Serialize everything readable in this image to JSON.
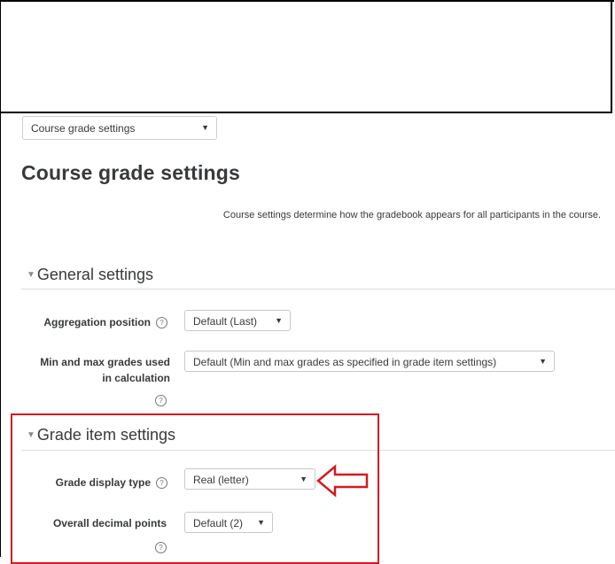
{
  "nav": {
    "selected": "Course grade settings"
  },
  "page": {
    "title": "Course grade settings",
    "intro": "Course settings determine how the gradebook appears for all participants in the course."
  },
  "general": {
    "heading": "General settings",
    "aggregation_label": "Aggregation position",
    "aggregation_value": "Default (Last)",
    "minmax_label_line1": "Min and max grades used",
    "minmax_label_line2": "in calculation",
    "minmax_value": "Default (Min and max grades as specified in grade item settings)"
  },
  "grade_item": {
    "heading": "Grade item settings",
    "display_type_label": "Grade display type",
    "display_type_value": "Real (letter)",
    "decimal_label": "Overall decimal points",
    "decimal_value": "Default (2)"
  },
  "annotation_color": "#d71920"
}
